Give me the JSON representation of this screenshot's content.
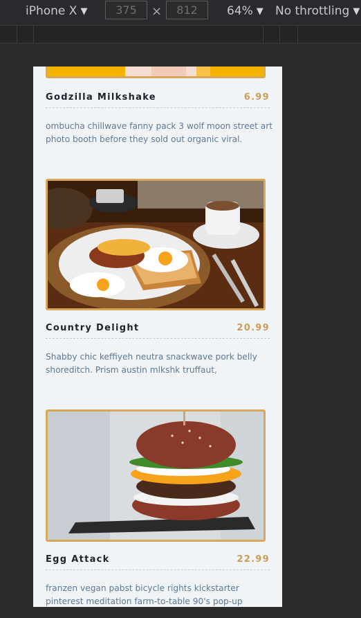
{
  "toolbar": {
    "device": "iPhone X",
    "width": "375",
    "height": "812",
    "times_symbol": "×",
    "zoom": "64%",
    "throttling": "No throttling",
    "caret_icon": "▼"
  },
  "menu": {
    "items": [
      {
        "name": "Godzilla Milkshake",
        "price": "6.99",
        "description": "ombucha chillwave fanny pack 3 wolf moon street art photo booth before they sold out organic viral."
      },
      {
        "name": "Country Delight",
        "price": "20.99",
        "description": "Shabby chic keffiyeh neutra snackwave pork belly shoreditch. Prism austin mlkshk truffaut,"
      },
      {
        "name": "Egg Attack",
        "price": "22.99",
        "description": "franzen vegan pabst bicycle rights kickstarter pinterest meditation farm-to-table 90's pop-up"
      }
    ]
  },
  "colors": {
    "frame": "#d7a75a",
    "price": "#c99e57",
    "description": "#5d7894",
    "name": "#1d232b",
    "page_bg": "#f1f4f7",
    "devtools_bg": "#292a2d"
  }
}
